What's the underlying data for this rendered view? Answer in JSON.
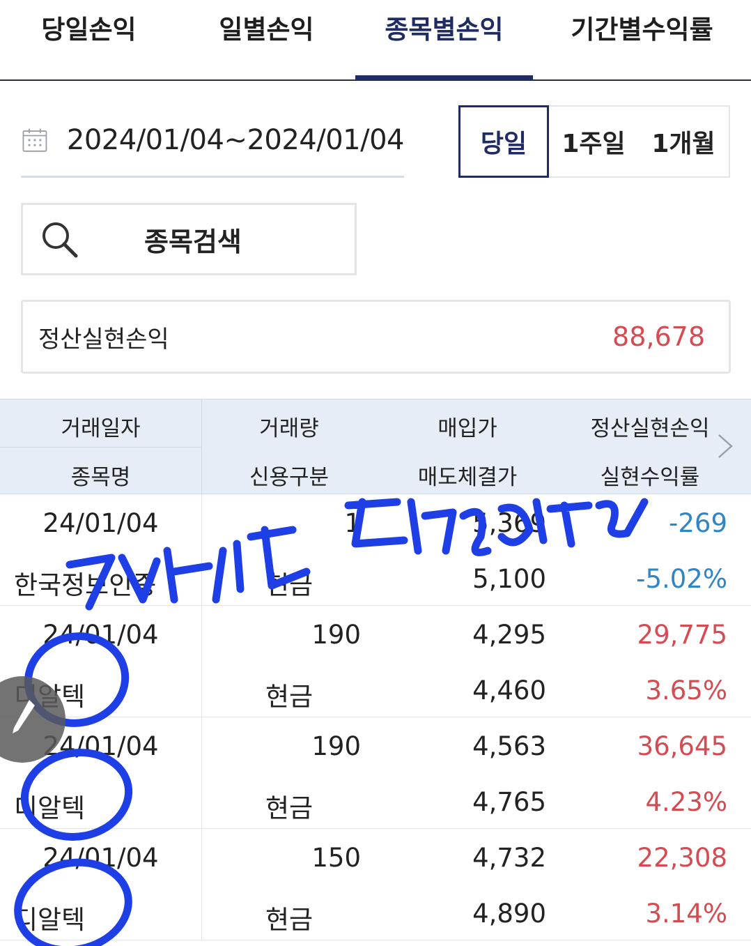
{
  "tabs": [
    {
      "label": "당일손익",
      "active": false
    },
    {
      "label": "일별손익",
      "active": false
    },
    {
      "label": "종목별손익",
      "active": true
    },
    {
      "label": "기간별수익률",
      "active": false
    }
  ],
  "date_range": {
    "icon": "calendar-icon",
    "value": "2024/01/04~2024/01/04"
  },
  "period_buttons": [
    {
      "label": "당일",
      "selected": true
    },
    {
      "label": "1주일",
      "selected": false
    },
    {
      "label": "1개월",
      "selected": false
    }
  ],
  "search": {
    "icon": "search-icon",
    "label": "종목검색"
  },
  "summary": {
    "label": "정산실현손익",
    "value": "88,678"
  },
  "table": {
    "headers": {
      "trade_date": "거래일자",
      "name": "종목명",
      "qty": "거래량",
      "credit": "신용구분",
      "buy_price": "매입가",
      "sell_price": "매도체결가",
      "pnl": "정산실현손익",
      "rate": "실현수익률"
    },
    "rows": [
      {
        "date": "24/01/04",
        "name": "한국정보인증",
        "qty": "1",
        "credit": "현금",
        "buy": "5,369",
        "sell": "5,100",
        "pnl": "-269",
        "rate": "-5.02%",
        "sign": "neg"
      },
      {
        "date": "24/01/04",
        "name": "디알텍",
        "qty": "190",
        "credit": "현금",
        "buy": "4,295",
        "sell": "4,460",
        "pnl": "29,775",
        "rate": "3.65%",
        "sign": "pos"
      },
      {
        "date": "24/01/04",
        "name": "디알텍",
        "qty": "190",
        "credit": "현금",
        "buy": "4,563",
        "sell": "4,765",
        "pnl": "36,645",
        "rate": "4.23%",
        "sign": "pos"
      },
      {
        "date": "24/01/04",
        "name": "디알텍",
        "qty": "150",
        "credit": "현금",
        "buy": "4,732",
        "sell": "4,890",
        "pnl": "22,308",
        "rate": "3.14%",
        "sign": "pos"
      }
    ]
  },
  "colors": {
    "accent": "#1f2c63",
    "positive": "#d64b52",
    "negative": "#2f86c6",
    "annotation_ink": "#1f3fe6"
  }
}
